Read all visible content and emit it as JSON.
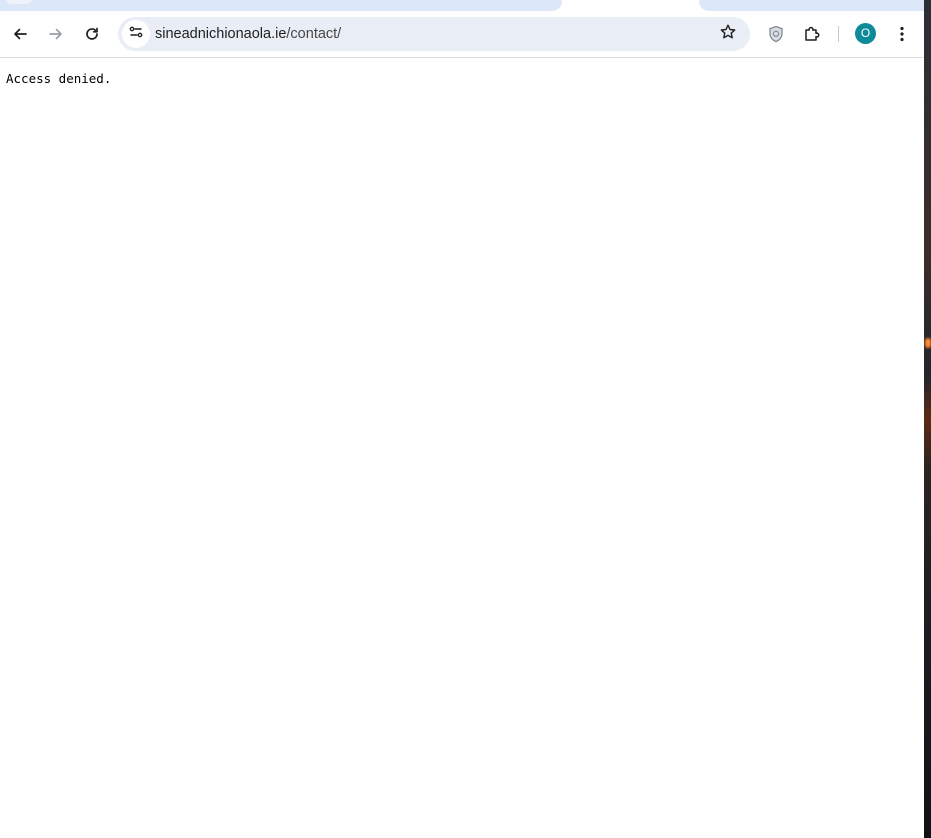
{
  "browser": {
    "url_host": "sineadnichionaola.ie",
    "url_path": "/contact/",
    "profile_initial": "O"
  },
  "icons": {
    "back": "arrow-left-icon",
    "forward": "arrow-right-icon",
    "reload": "reload-icon",
    "site_info": "tune-icon",
    "bookmark": "star-icon",
    "extension_shield": "shield-icon",
    "extensions": "puzzle-icon",
    "menu": "kebab-menu-icon"
  },
  "colors": {
    "omnibox_bg": "#e9eef6",
    "tab_bg": "#dce7f8",
    "avatar": "#0f8a99"
  },
  "page": {
    "message": "Access denied."
  }
}
